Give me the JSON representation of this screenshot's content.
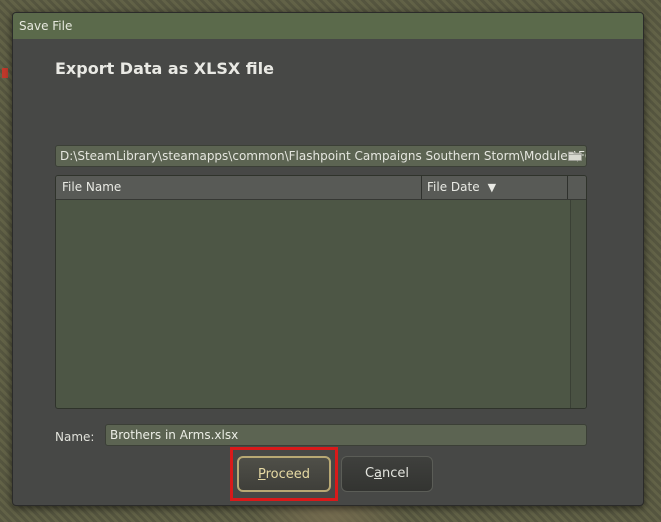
{
  "window": {
    "title": "Save File"
  },
  "dialog": {
    "heading": "Export Data as XLSX file"
  },
  "path": {
    "value": "D:\\SteamLibrary\\steamapps\\common\\Flashpoint Campaigns Southern Storm\\Modules\\FC",
    "icon": "folder-icon"
  },
  "file_list": {
    "columns": [
      "File Name",
      "File Date"
    ],
    "sort_indicator": "▼",
    "rows": []
  },
  "name_field": {
    "label": "Name:",
    "value": "Brothers in Arms.xlsx"
  },
  "buttons": {
    "proceed": {
      "first": "P",
      "rest": "roceed"
    },
    "cancel": {
      "first": "C",
      "underlined": "a",
      "rest": "ncel"
    }
  },
  "colors": {
    "titlebar": "#5b6a4b",
    "dialog_bg": "#474846",
    "highlight": "#d91a1a"
  }
}
